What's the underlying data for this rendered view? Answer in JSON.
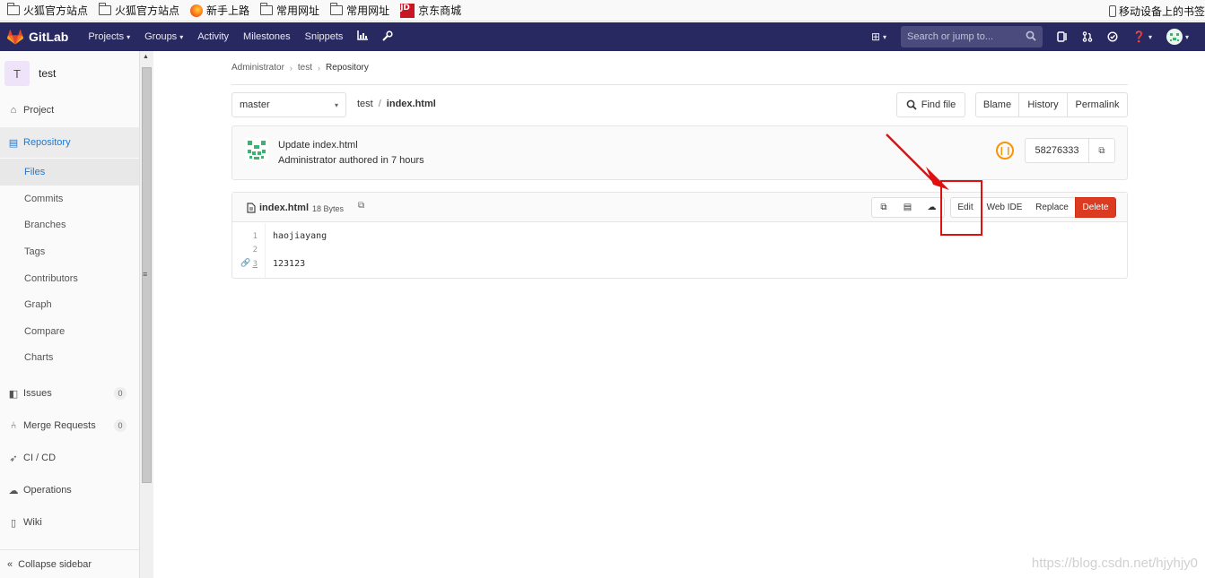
{
  "bookmarks": {
    "items": [
      "火狐官方站点",
      "火狐官方站点",
      "新手上路",
      "常用网址",
      "常用网址",
      "京东商城"
    ],
    "jd_logo": "JD",
    "mobile": "移动设备上的书签"
  },
  "navbar": {
    "brand": "GitLab",
    "links": [
      "Projects",
      "Groups",
      "Activity",
      "Milestones",
      "Snippets"
    ],
    "search_placeholder": "Search or jump to..."
  },
  "sidebar": {
    "project_initial": "T",
    "project_name": "test",
    "project": "Project",
    "repository": "Repository",
    "sub": [
      "Files",
      "Commits",
      "Branches",
      "Tags",
      "Contributors",
      "Graph",
      "Compare",
      "Charts"
    ],
    "issues": "Issues",
    "issues_count": "0",
    "merge_requests": "Merge Requests",
    "mr_count": "0",
    "cicd": "CI / CD",
    "operations": "Operations",
    "wiki": "Wiki",
    "collapse": "Collapse sidebar"
  },
  "breadcrumb": [
    "Administrator",
    "test",
    "Repository"
  ],
  "repo": {
    "branch": "master",
    "path_project": "test",
    "path_file": "index.html",
    "find_file": "Find file",
    "blame": "Blame",
    "history": "History",
    "permalink": "Permalink"
  },
  "commit": {
    "title": "Update index.html",
    "meta": "Administrator authored in 7 hours",
    "sha": "58276333"
  },
  "file": {
    "name": "index.html",
    "size": "18 Bytes",
    "edit": "Edit",
    "web_ide": "Web IDE",
    "replace": "Replace",
    "delete": "Delete",
    "line_numbers": [
      "1",
      "2",
      "3"
    ],
    "lines": [
      "haojiayang",
      "",
      "123123"
    ]
  },
  "colors": {
    "navbar": "#292961",
    "accent": "#1f78d1",
    "delete": "#db3b21",
    "pipeline": "#fc9403",
    "annotation": "#e01010"
  },
  "watermark": "https://blog.csdn.net/hjyhjy0"
}
